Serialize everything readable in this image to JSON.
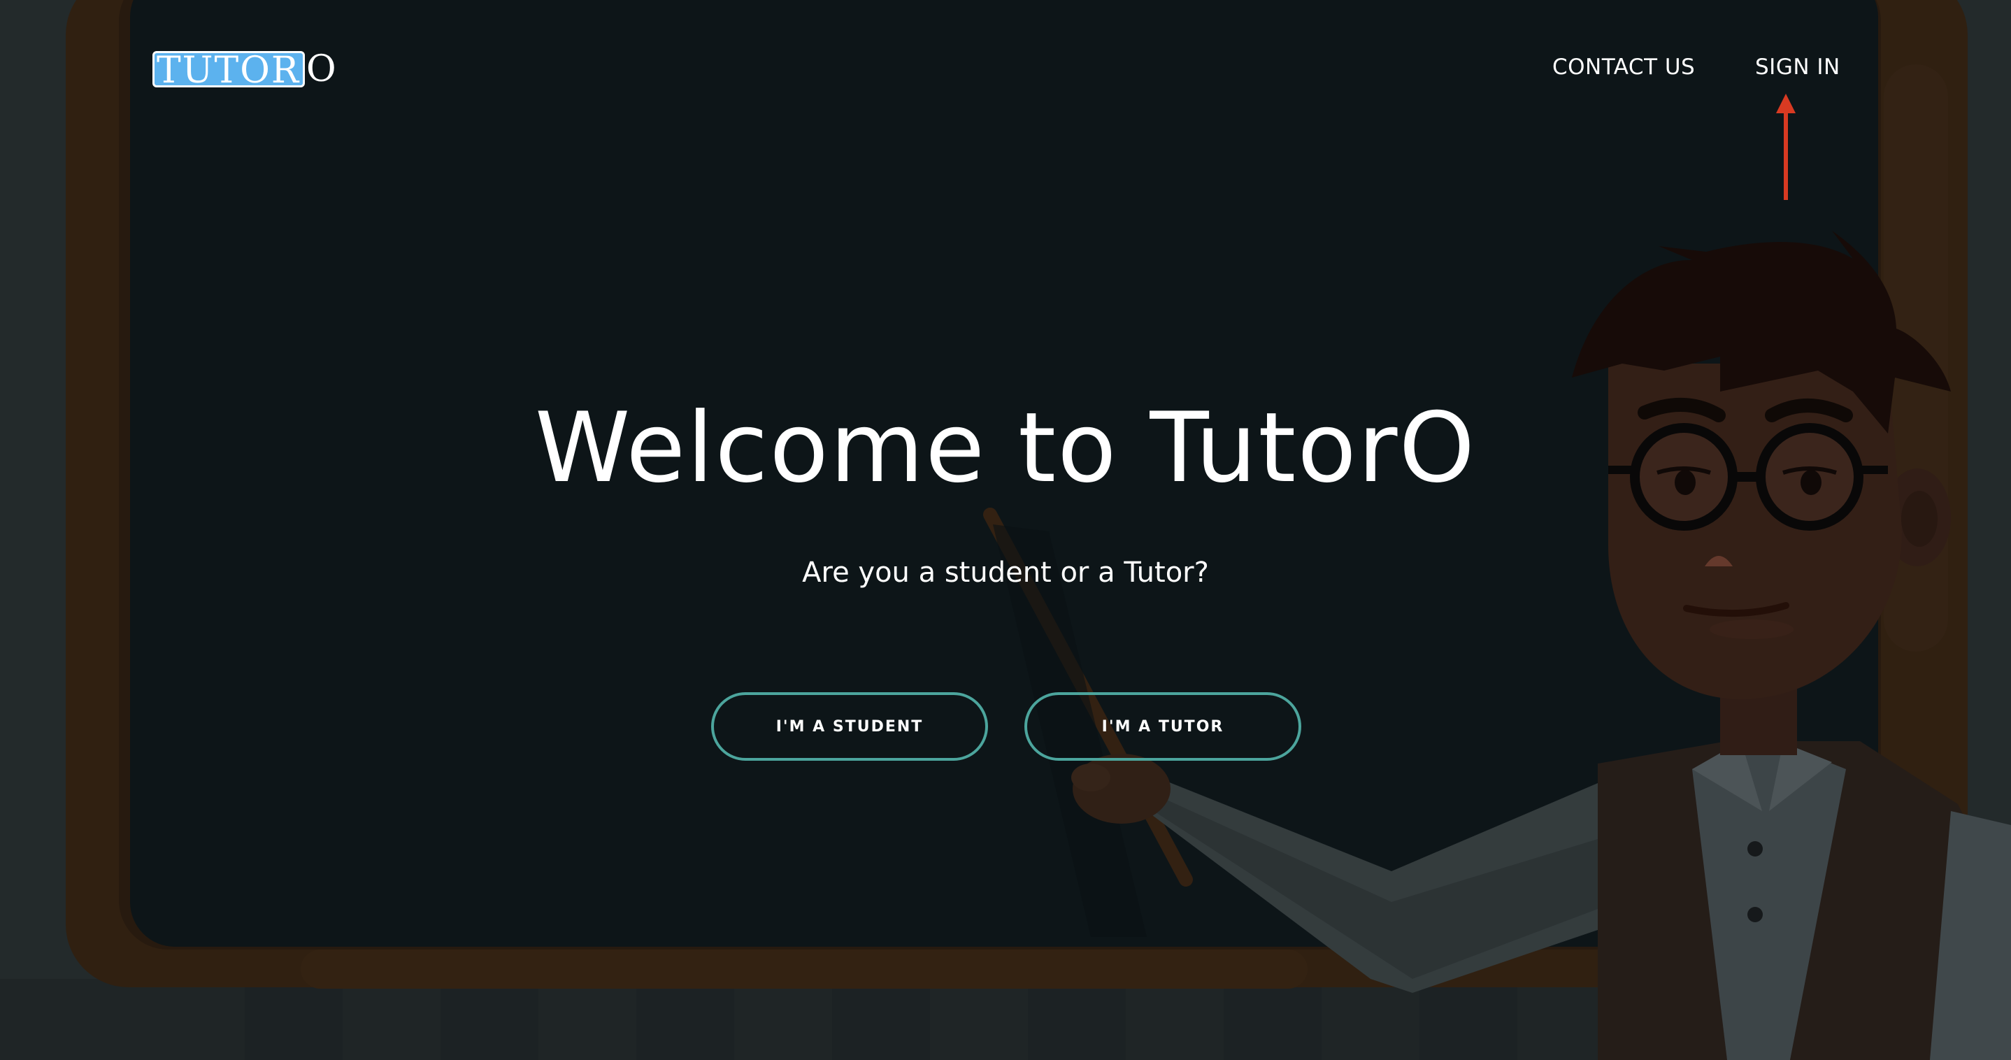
{
  "header": {
    "logo": {
      "boxed_text": "TUTOR",
      "tail_text": "O"
    },
    "nav": {
      "contact_label": "CONTACT US",
      "signin_label": "SIGN IN"
    }
  },
  "hero": {
    "title": "Welcome to TutorO",
    "subtitle": "Are you a student or a Tutor?",
    "buttons": {
      "student_label": "I'M A STUDENT",
      "tutor_label": "I'M A TUTOR"
    }
  },
  "icons": {
    "annotation": "up-arrow-icon",
    "background": "teacher-at-chalkboard-illustration"
  },
  "colors": {
    "chalkboard": "#0f181c",
    "board_frame": "#3a2513",
    "logo_box": "#5cb2ee",
    "button_border": "#4ca59d",
    "annotation_arrow": "#d83a22"
  }
}
